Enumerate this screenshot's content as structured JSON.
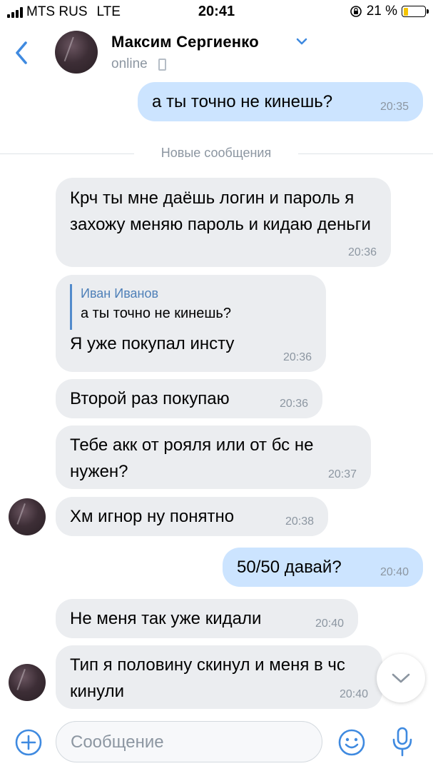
{
  "status_bar": {
    "carrier": "MTS RUS",
    "network": "LTE",
    "time": "20:41",
    "battery_percent": "21 %",
    "battery_level": 0.21
  },
  "header": {
    "back_icon": "chevron-left-icon",
    "contact_name": "Максим Сергиенко",
    "presence": "online",
    "accent_color": "#3f8ae0"
  },
  "divider": {
    "label": "Новые сообщения"
  },
  "messages": [
    {
      "direction": "out",
      "text": "а ты точно не кинешь?",
      "time": "20:35"
    },
    {
      "direction": "in",
      "text": "Крч ты мне даёшь логин и пароль я захожу меняю пароль и кидаю деньги",
      "time": "20:36"
    },
    {
      "direction": "in",
      "reply_author": "Иван Иванов",
      "reply_text": "а ты точно не кинешь?",
      "text": "Я уже покупал инсту",
      "time": "20:36"
    },
    {
      "direction": "in",
      "text": "Второй раз покупаю",
      "time": "20:36"
    },
    {
      "direction": "in",
      "text": "Тебе акк от рояля или от бс не нужен?",
      "time": "20:37"
    },
    {
      "direction": "in",
      "text": "Хм игнор ну понятно",
      "time": "20:38"
    },
    {
      "direction": "out",
      "text": "50/50 давай?",
      "time": "20:40"
    },
    {
      "direction": "in",
      "text": "Не меня так уже кидали",
      "time": "20:40"
    },
    {
      "direction": "in",
      "text": "Тип я половину скинул и меня в чс кинули",
      "time": "20:40"
    }
  ],
  "composer": {
    "placeholder": "Сообщение",
    "attach_icon": "plus-circle-icon",
    "emoji_icon": "smile-icon",
    "voice_icon": "microphone-icon"
  },
  "colors": {
    "incoming_bubble": "#ebedf0",
    "outgoing_bubble": "#cce4ff",
    "timestamp": "#8c96a1",
    "reply_author": "#4f80b8"
  }
}
